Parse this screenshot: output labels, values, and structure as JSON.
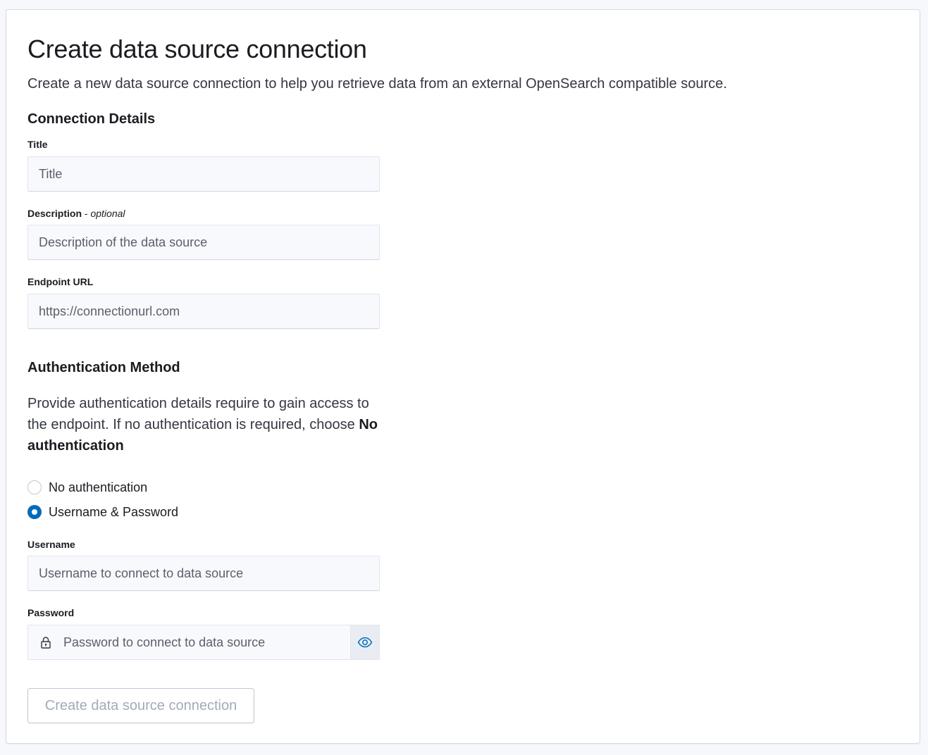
{
  "page": {
    "title": "Create data source connection",
    "description": "Create a new data source connection to help you retrieve data from an external OpenSearch compatible source."
  },
  "connection_details": {
    "heading": "Connection Details",
    "title_field": {
      "label": "Title",
      "placeholder": "Title",
      "value": ""
    },
    "description_field": {
      "label": "Description",
      "separator": " - ",
      "optional_text": "optional",
      "placeholder": "Description of the data source",
      "value": ""
    },
    "endpoint_field": {
      "label": "Endpoint URL",
      "placeholder": "https://connectionurl.com",
      "value": ""
    }
  },
  "authentication": {
    "heading": "Authentication Method",
    "description_prefix": "Provide authentication details require to gain access to the endpoint. If no authentication is required, choose ",
    "description_emphasis": "No authentication",
    "options": [
      {
        "label": "No authentication",
        "selected": false
      },
      {
        "label": "Username & Password",
        "selected": true
      }
    ],
    "username_field": {
      "label": "Username",
      "placeholder": "Username to connect to data source",
      "value": ""
    },
    "password_field": {
      "label": "Password",
      "placeholder": "Password to connect to data source",
      "value": ""
    },
    "icons": {
      "lock": "lock-icon",
      "reveal": "eye-icon"
    }
  },
  "actions": {
    "submit_label": "Create data source connection",
    "submit_disabled": true
  },
  "colors": {
    "accent": "#006bb8",
    "disabled_text": "#a2abba",
    "input_bg": "#f7f9fc"
  }
}
